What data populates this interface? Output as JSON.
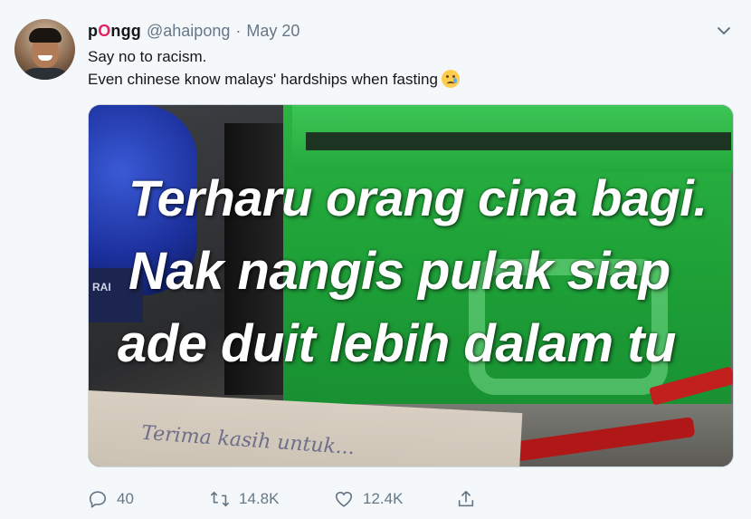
{
  "tweet": {
    "display_name_prefix": "p",
    "display_name_o": "O",
    "display_name_suffix": "ngg",
    "handle": "@ahaipong",
    "separator": "·",
    "date": "May 20",
    "text_line1": "Say no to racism.",
    "text_line2": "Even chinese know malays' hardships when fasting",
    "emoji": "crying-face-emoji"
  },
  "media": {
    "caption_line1": "Terharu orang cina  bagi.",
    "caption_line2": "Nak nangis pulak siap",
    "caption_line3": "ade duit lebih dalam tu",
    "handwritten_note": "Terima kasih untuk..."
  },
  "actions": {
    "reply_count": "40",
    "retweet_count": "14.8K",
    "like_count": "12.4K"
  },
  "icons": {
    "reply": "reply-icon",
    "retweet": "retweet-icon",
    "like": "heart-icon",
    "share": "share-icon",
    "more": "chevron-down-icon"
  },
  "colors": {
    "background": "#f5f8fa",
    "text": "#14171a",
    "secondary": "#657786",
    "accent_o": "#e0245e"
  }
}
